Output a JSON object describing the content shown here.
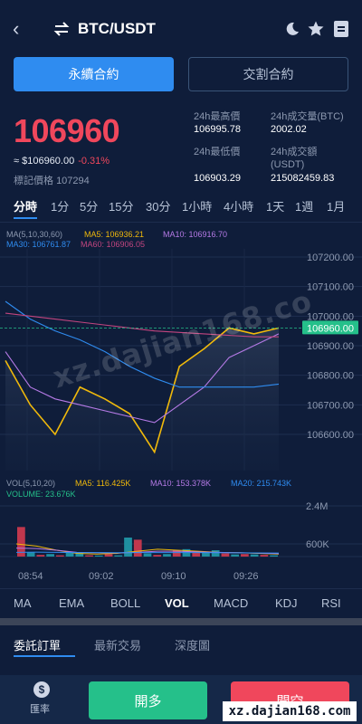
{
  "header": {
    "pair": "BTC/USDT",
    "icons": [
      "back-icon",
      "swap-icon",
      "moon-icon",
      "star-icon",
      "doc-icon"
    ]
  },
  "contract_tabs": {
    "perpetual": "永續合約",
    "delivery": "交割合約"
  },
  "price": {
    "last": "106960",
    "approx": "≈ $106960.00",
    "change": "-0.31%",
    "mark_label": "標記價格",
    "mark_value": "107294"
  },
  "stats": {
    "high_label": "24h最高價",
    "high_value": "106995.78",
    "vol_btc_label": "24h成交量(BTC)",
    "vol_btc_value": "2002.02",
    "low_label": "24h最低價",
    "low_value": "106903.29",
    "turnover_label_1": "24h成交額",
    "turnover_label_2": "(USDT)",
    "turnover_value": "215082459.83"
  },
  "timeframes": [
    "分時",
    "1分",
    "5分",
    "15分",
    "30分",
    "1小時",
    "4小時",
    "1天",
    "1週",
    "1月"
  ],
  "main_legend": {
    "ma_params": "MA(5,10,30,60)",
    "ma5": "MA5: 106936.21",
    "ma10": "MA10: 106916.70",
    "ma30": "MA30: 106761.87",
    "ma60": "MA60: 106906.05"
  },
  "price_axis": [
    "107200.00",
    "107100.00",
    "107000.00",
    "106900.00",
    "106800.00",
    "106700.00",
    "106600.00"
  ],
  "current_price_tag": "106960.00",
  "vol_legend": {
    "params": "VOL(5,10,20)",
    "ma5": "MA5: 116.425K",
    "ma10": "MA10: 153.378K",
    "ma20": "MA20: 215.743K",
    "volume": "VOLUME: 23.676K"
  },
  "vol_axis": [
    "2.4M",
    "600K"
  ],
  "time_axis": [
    "08:54",
    "09:02",
    "09:10",
    "09:26"
  ],
  "indicators": [
    "MA",
    "EMA",
    "BOLL",
    "VOL",
    "MACD",
    "KDJ",
    "RSI"
  ],
  "active_indicator": "VOL",
  "order_tabs": [
    "委託訂單",
    "最新交易",
    "深度圖"
  ],
  "bottom": {
    "rate_label": "匯率",
    "rate_glyph": "$",
    "buy": "開多",
    "sell": "開空"
  },
  "watermark": {
    "banner": "xz.dajian168.com",
    "diagonal": "xz.dajian168.co"
  },
  "colors": {
    "background": "#0f1d3a",
    "accent": "#2f8cf0",
    "up": "#25c08a",
    "down": "#f0475c",
    "ma5": "#f0b90b",
    "ma10": "#b57ae6",
    "ma30": "#2f8cf0",
    "ma60": "#c2457f"
  },
  "chart_data": {
    "type": "line",
    "y_axis_ticks": [
      107200,
      107100,
      107000,
      106900,
      106800,
      106700,
      106600
    ],
    "ylim": [
      106545,
      107260
    ],
    "current_price": 106960,
    "series": [
      {
        "name": "MA5",
        "values": [
          106850,
          106700,
          106600,
          106760,
          106720,
          106670,
          106540,
          106830,
          106890,
          106960,
          106940,
          106960
        ]
      },
      {
        "name": "MA10",
        "values": [
          106880,
          106760,
          106720,
          106700,
          106680,
          106660,
          106640,
          106700,
          106760,
          106860,
          106900,
          106940
        ]
      },
      {
        "name": "MA30",
        "values": [
          107050,
          106990,
          106950,
          106920,
          106880,
          106830,
          106790,
          106760,
          106760,
          106760,
          106760,
          106770
        ]
      },
      {
        "name": "MA60",
        "values": [
          107010,
          107000,
          106990,
          106980,
          106970,
          106960,
          106950,
          106945,
          106940,
          106935,
          106930,
          106930
        ]
      }
    ],
    "volume": {
      "times": [
        "08:54",
        "09:02",
        "09:10",
        "09:26"
      ],
      "y_axis_ticks": [
        "2.4M",
        "600K"
      ],
      "ylim": [
        0,
        3000000
      ],
      "bars": [
        {
          "v": 1400000,
          "up": false
        },
        {
          "v": 200000,
          "up": true
        },
        {
          "v": 80000,
          "up": false
        },
        {
          "v": 120000,
          "up": true
        },
        {
          "v": 60000,
          "up": false
        },
        {
          "v": 200000,
          "up": true
        },
        {
          "v": 200000,
          "up": true
        },
        {
          "v": 60000,
          "up": false
        },
        {
          "v": 50000,
          "up": true
        },
        {
          "v": 120000,
          "up": false
        },
        {
          "v": 60000,
          "up": true
        },
        {
          "v": 900000,
          "up": true
        },
        {
          "v": 800000,
          "up": false
        },
        {
          "v": 150000,
          "up": true
        },
        {
          "v": 80000,
          "up": false
        },
        {
          "v": 120000,
          "up": true
        },
        {
          "v": 300000,
          "up": false
        },
        {
          "v": 350000,
          "up": true
        },
        {
          "v": 250000,
          "up": false
        },
        {
          "v": 180000,
          "up": true
        },
        {
          "v": 300000,
          "up": true
        },
        {
          "v": 150000,
          "up": false
        },
        {
          "v": 100000,
          "up": true
        },
        {
          "v": 120000,
          "up": false
        },
        {
          "v": 100000,
          "up": true
        },
        {
          "v": 80000,
          "up": false
        },
        {
          "v": 60000,
          "up": true
        }
      ]
    }
  }
}
